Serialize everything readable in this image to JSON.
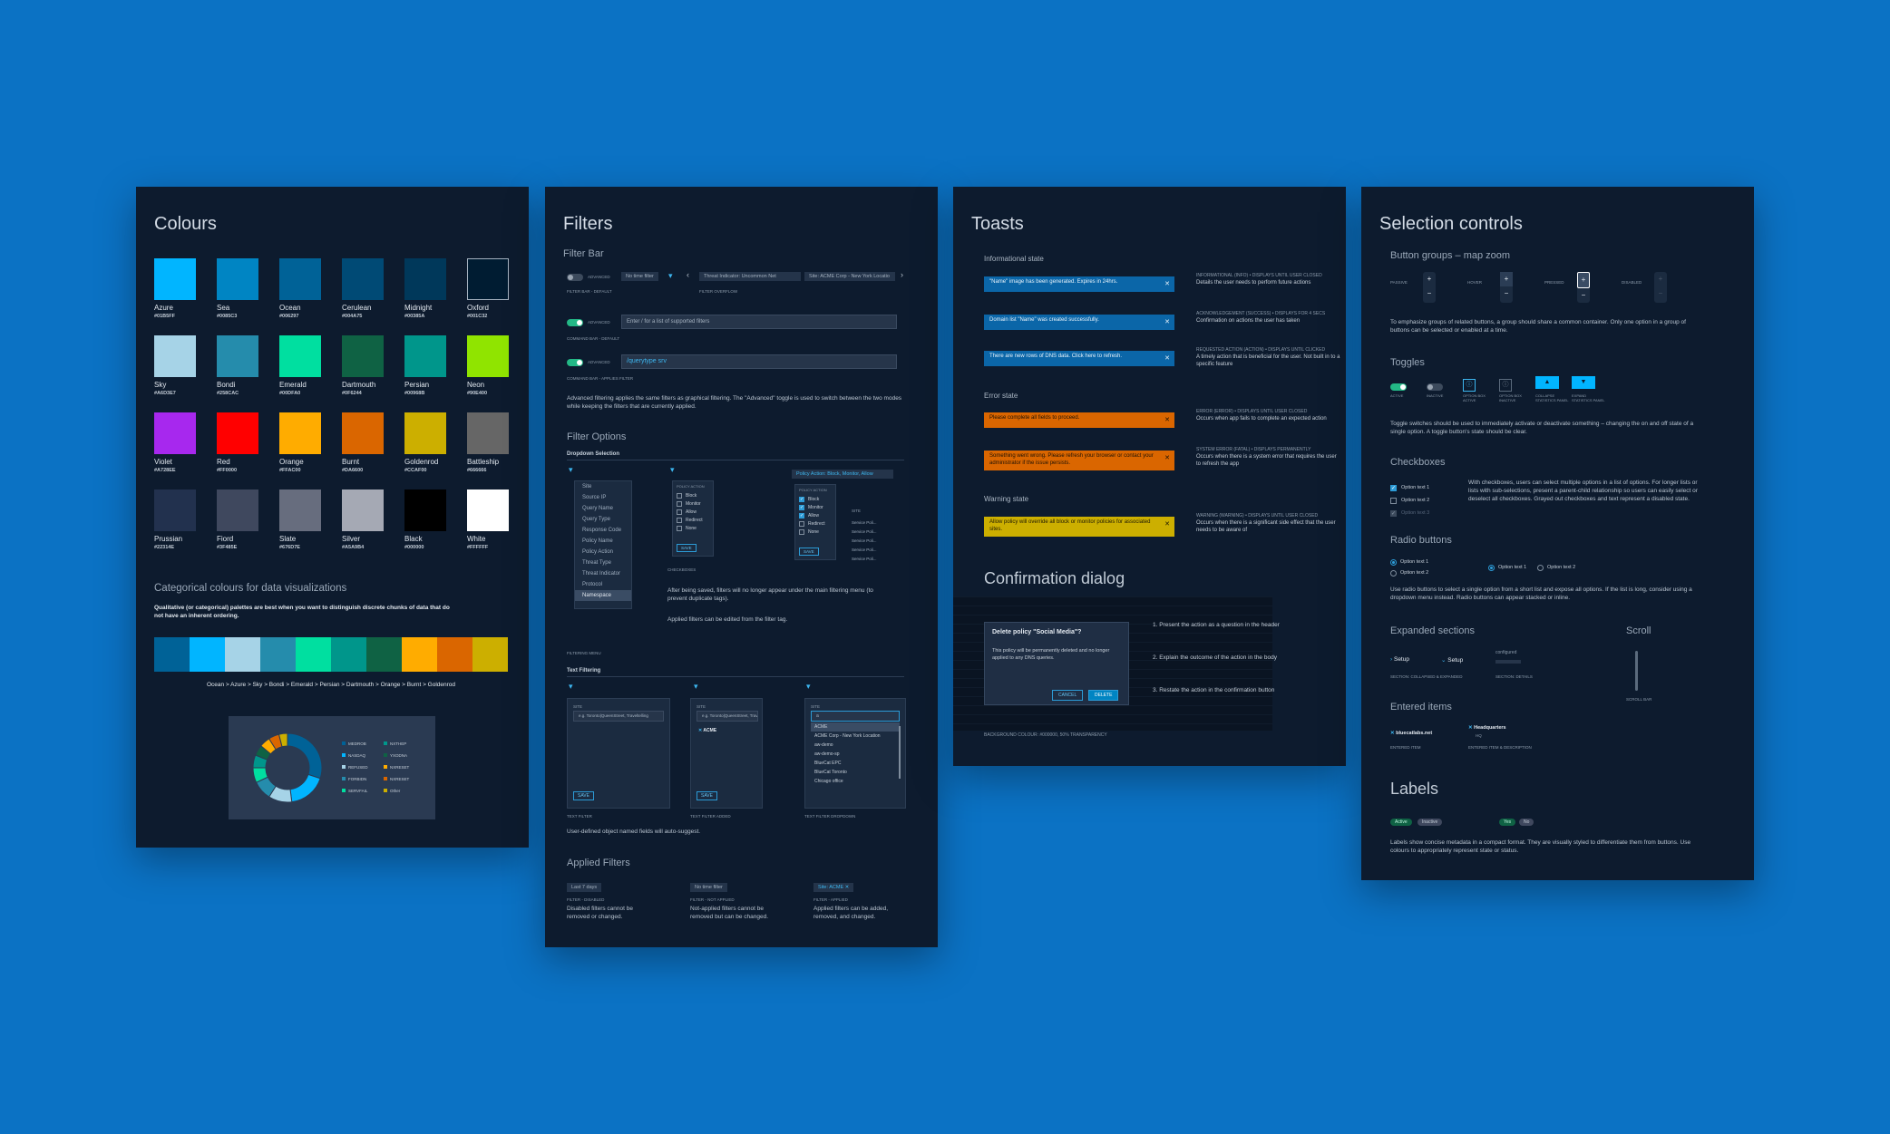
{
  "colors_panel": {
    "title": "Colours",
    "swatches": [
      {
        "name": "Azure",
        "hex": "#01B5FF"
      },
      {
        "name": "Sea",
        "hex": "#0085C3"
      },
      {
        "name": "Ocean",
        "hex": "#006297"
      },
      {
        "name": "Cerulean",
        "hex": "#004A75"
      },
      {
        "name": "Midnight",
        "hex": "#00385A"
      },
      {
        "name": "Oxford",
        "hex": "#001C32"
      },
      {
        "name": "Sky",
        "hex": "#A6D3E7"
      },
      {
        "name": "Bondi",
        "hex": "#258CAC"
      },
      {
        "name": "Emerald",
        "hex": "#00DFA0"
      },
      {
        "name": "Dartmouth",
        "hex": "#0F6244"
      },
      {
        "name": "Persian",
        "hex": "#00968B"
      },
      {
        "name": "Neon",
        "hex": "#90E400"
      },
      {
        "name": "Violet",
        "hex": "#A728EE"
      },
      {
        "name": "Red",
        "hex": "#FF0000"
      },
      {
        "name": "Orange",
        "hex": "#FFAC00"
      },
      {
        "name": "Burnt",
        "hex": "#DA6600"
      },
      {
        "name": "Goldenrod",
        "hex": "#CCAF00"
      },
      {
        "name": "Battleship",
        "hex": "#666666"
      },
      {
        "name": "Prussian",
        "hex": "#22314E"
      },
      {
        "name": "Fiord",
        "hex": "#3F485E"
      },
      {
        "name": "Slate",
        "hex": "#676D7E"
      },
      {
        "name": "Silver",
        "hex": "#A5A9B4"
      },
      {
        "name": "Black",
        "hex": "#000000"
      },
      {
        "name": "White",
        "hex": "#FFFFFF"
      }
    ],
    "categorical_title": "Categorical colours for data visualizations",
    "categorical_desc": "Qualitative (or categorical) palettes are best when you want to distinguish discrete chunks of data that do not have an inherent ordering.",
    "categorical_sequence": [
      "#006297",
      "#01B5FF",
      "#A6D3E7",
      "#258CAC",
      "#00DFA0",
      "#00968B",
      "#0F6244",
      "#FFAC00",
      "#DA6600",
      "#CCAF00"
    ],
    "sequence_caption": "Ocean > Azure > Sky > Bondi > Emerald > Persian > Dartmouth > Orange > Burnt > Goldenrod"
  },
  "chart_data": {
    "type": "pie",
    "categories": [
      "MEDROB",
      "NASDAQ",
      "REFUSED",
      "FORBIDN",
      "SERVFAIL",
      "NXTHEP",
      "YXODNA",
      "NXRESET",
      "NXRESET",
      "Other"
    ],
    "values": [
      30,
      18,
      11,
      9,
      7,
      6,
      5,
      5,
      5,
      4
    ],
    "colors": [
      "#006297",
      "#01B5FF",
      "#A6D3E7",
      "#258CAC",
      "#00DFA0",
      "#00968B",
      "#0F6244",
      "#FFAC00",
      "#DA6600",
      "#CCAF00"
    ]
  },
  "filters_panel": {
    "title": "Filters",
    "filter_bar_heading": "Filter Bar",
    "advanced_label": "ADVANCED",
    "no_time_filter": "No time filter",
    "threat_chip": "Threat Indicator: Uncommon Net",
    "site_chip": "Site: ACME Corp - New York Locatio",
    "filter_bar_default": "FILTER BAR - DEFAULT",
    "filter_overflow": "FILTER OVERFLOW",
    "command_placeholder": "Enter / for a list of supported filters",
    "command_default": "COMMAND BAR - DEFAULT",
    "command_value": "/querytype srv",
    "command_applies": "COMMAND BAR - APPLIES FILTER",
    "advanced_desc": "Advanced filtering applies the same filters as graphical filtering. The \"Advanced\" toggle is used to switch between the two modes while keeping the filters that are currently applied.",
    "filter_options_heading": "Filter Options",
    "dropdown_selection": "Dropdown Selection",
    "filter_menu_items": [
      "Site",
      "Source IP",
      "Query Name",
      "Query Type",
      "Response Code",
      "Policy Name",
      "Policy Action",
      "Threat Type",
      "Threat Indicator",
      "Protocol",
      "Namespace"
    ],
    "filtering_menu_caption": "FILTERING MENU",
    "policy_action_label": "POLICY ACTION",
    "policy_actions": [
      "Block",
      "Monitor",
      "Allow",
      "Redirect",
      "None"
    ],
    "save_label": "SAVE",
    "checkboxes_caption": "CHECKBOXES",
    "policy_chip": "Policy Action: Block, Monitor, Allow",
    "site_col": "SITE",
    "service_rows": [
      "Service Poli...",
      "Service Poli...",
      "Service Poli...",
      "Service Poli...",
      "Service Poli..."
    ],
    "after_save_desc": "After being saved, filters will no longer appear under the main filtering menu (to prevent duplicate tags).",
    "applied_edit_desc": "Applied filters can be edited from the filter tag.",
    "text_filtering": "Text Filtering",
    "site_field_label": "SITE",
    "text_placeholder": "e.g. Toronto|QueenStreet, Traveltelling",
    "acme_entry": "ACME",
    "dropdown_input": "a",
    "dropdown_options": [
      "ACME",
      "ACME Corp - New York Location",
      "aw-demo",
      "aw-demo-sp",
      "BlueCat EPC",
      "BlueCat Toronto",
      "Chicago office"
    ],
    "text_filter_caption": "TEXT FILTER",
    "text_filter_added": "TEXT FILTER ADDED",
    "text_filter_dropdown": "TEXT FILTER DROPDOWN",
    "auto_suggest": "User-defined object named fields will auto-suggest.",
    "applied_heading": "Applied Filters",
    "applied": [
      {
        "chip": "Last 7 days",
        "caption": "FILTER - DISABLED",
        "desc": "Disabled filters cannot be removed or changed."
      },
      {
        "chip": "No time filter",
        "caption": "FILTER - NOT APPLIED",
        "desc": "Not-applied filters cannot be removed but can be changed."
      },
      {
        "chip": "Site: ACME ✕",
        "caption": "FILTER - APPLIED",
        "desc": "Applied filters can be added, removed, and changed."
      }
    ]
  },
  "toasts_panel": {
    "title": "Toasts",
    "informational_heading": "Informational state",
    "toasts_info": [
      {
        "msg": "\"Name\" image has been generated. Expires in 24hrs.",
        "cap": "INFORMATIONAL (INFO) • DISPLAYS UNTIL USER CLOSED",
        "desc": "Details the user needs to perform future actions"
      },
      {
        "msg": "Domain list \"Name\" was created successfully.",
        "cap": "ACKNOWLEDGEMENT (SUCCESS) • DISPLAYS FOR 4 SECS",
        "desc": "Confirmation on actions the user has taken"
      },
      {
        "msg": "There are new rows of DNS data. Click here to refresh.",
        "cap": "REQUESTED ACTION (ACTION) • DISPLAYS UNTIL CLICKED",
        "desc": "A timely action that is beneficial for the user. Not built in to a specific feature"
      }
    ],
    "error_heading": "Error state",
    "toasts_error": [
      {
        "msg": "Please complete all fields to proceed.",
        "cap": "ERROR (ERROR) • DISPLAYS UNTIL USER CLOSED",
        "desc": "Occurs when app fails to complete an expected action"
      },
      {
        "msg": "Something went wrong. Please refresh your browser or contact your administrator if the issue persists.",
        "cap": "SYSTEM ERROR (FATAL) • DISPLAYS PERMANENTLY",
        "desc": "Occurs when there is a system error that requires the user to refresh the app"
      }
    ],
    "warning_heading": "Warning state",
    "toasts_warning": [
      {
        "msg": "Allow policy will override all block or monitor policies for associated sites.",
        "cap": "WARNING (WARNING) • DISPLAYS UNTIL USER CLOSED",
        "desc": "Occurs when there is a significant side effect that the user needs to be aware of"
      }
    ],
    "confirm_heading": "Confirmation dialog",
    "dialog_title": "Delete policy \"Social Media\"?",
    "dialog_body": "This policy will be permanently deleted and no longer applied to any DNS queries.",
    "cancel_label": "CANCEL",
    "delete_label": "DELETE",
    "steps": [
      "1. Present the action as a question in the header",
      "2. Explain the outcome of the action in the body",
      "3. Restate the action in the confirmation button"
    ],
    "bg_caption": "BACKGROUND COLOUR: #000000, 50% TRANSPARENCY"
  },
  "selection_panel": {
    "title": "Selection controls",
    "button_groups_heading": "Button groups – map zoom",
    "zoom_states": [
      "PASSIVE",
      "HOVER",
      "PRESSED",
      "DISABLED"
    ],
    "button_groups_desc": "To emphasize groups of related buttons, a group should share a common container. Only one option in a group of buttons can be selected or enabled at a time.",
    "toggles_heading": "Toggles",
    "toggle_states": [
      "ACTIVE",
      "INACTIVE",
      "OPTION BOX ACTIVE",
      "OPTION BOX INACTIVE",
      "COLLAPSE STATISTICS PANEL",
      "EXPAND STATISTICS PANEL"
    ],
    "toggles_desc": "Toggle switches should be used to immediately activate or deactivate something – changing the on and off state of a single option. A toggle button's state should be clear.",
    "checkboxes_heading": "Checkboxes",
    "checkbox_options": [
      "Option text 1",
      "Option text 2",
      "Option text 3"
    ],
    "checkboxes_desc": "With checkboxes, users can select multiple options in a list of options. For longer lists or lists with sub-selections, present a parent-child relationship so users can easily select or deselect all checkboxes. Grayed out checkboxes and text represent a disabled state.",
    "radio_heading": "Radio buttons",
    "radio_options": [
      "Option text 1",
      "Option text 2"
    ],
    "radio_desc": "Use radio buttons to select a single option from a short list and expose all options. If the list is long, consider using a dropdown menu instead. Radio buttons can appear stacked or inline.",
    "expanded_heading": "Expanded sections",
    "setup_label": "Setup",
    "config_label": "configured",
    "section_caption_1": "SECTION: COLLAPSED & EXPANDED",
    "section_caption_2": "SECTION: DETAILS",
    "scroll_heading": "Scroll",
    "scroll_caption": "SCROLL BAR",
    "entered_heading": "Entered items",
    "entered_1": "bluecatlabs.net",
    "entered_2": "Headquarters",
    "entered_2_sub": "HQ",
    "entered_cap_1": "ENTERED ITEM",
    "entered_cap_2": "ENTERED ITEM & DESCRIPTION",
    "labels_heading": "Labels",
    "labels": [
      "Active",
      "Inactive",
      "Yes",
      "No"
    ],
    "labels_desc": "Labels show concise metadata in a compact format. They are visually styled to differentiate them from buttons. Use colours to appropriately represent state or status."
  }
}
